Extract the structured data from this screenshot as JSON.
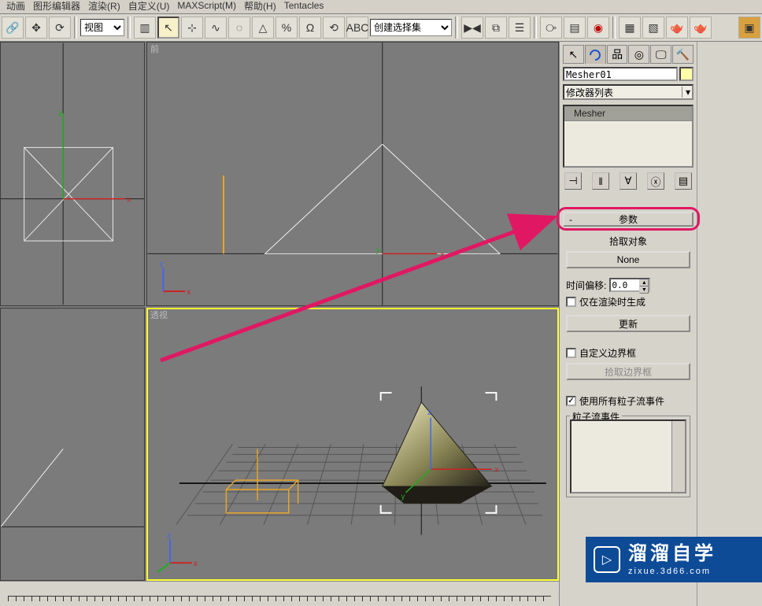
{
  "menu": {
    "items": [
      "动画",
      "图形编辑器",
      "渲染(R)",
      "自定义(U)",
      "MAXScript(M)",
      "帮助(H)",
      "Tentacles"
    ]
  },
  "toolbar": {
    "view_dropdown": "视图",
    "selection_set_placeholder": "创建选择集"
  },
  "viewports": {
    "top_left": "",
    "top_right": "前",
    "bottom_left": "",
    "bottom_right": "透视",
    "axes": {
      "x": "x",
      "y": "y",
      "z": "z"
    }
  },
  "panel": {
    "object_name": "Mesher01",
    "modifier_list_label": "修改器列表",
    "stack_item": "Mesher",
    "rollout_title": "参数",
    "pick_object_label": "拾取对象",
    "none_btn": "None",
    "time_offset_label": "时间偏移:",
    "time_offset_value": "0.0",
    "render_only_label": "仅在渲染时生成",
    "update_btn": "更新",
    "custom_bbox_label": "自定义边界框",
    "pick_bbox_btn": "拾取边界框",
    "use_all_pf_label": "使用所有粒子流事件",
    "pf_events_group": "粒子流事件"
  },
  "watermark": {
    "big": "溜溜自学",
    "small": "zixue.3d66.com"
  }
}
